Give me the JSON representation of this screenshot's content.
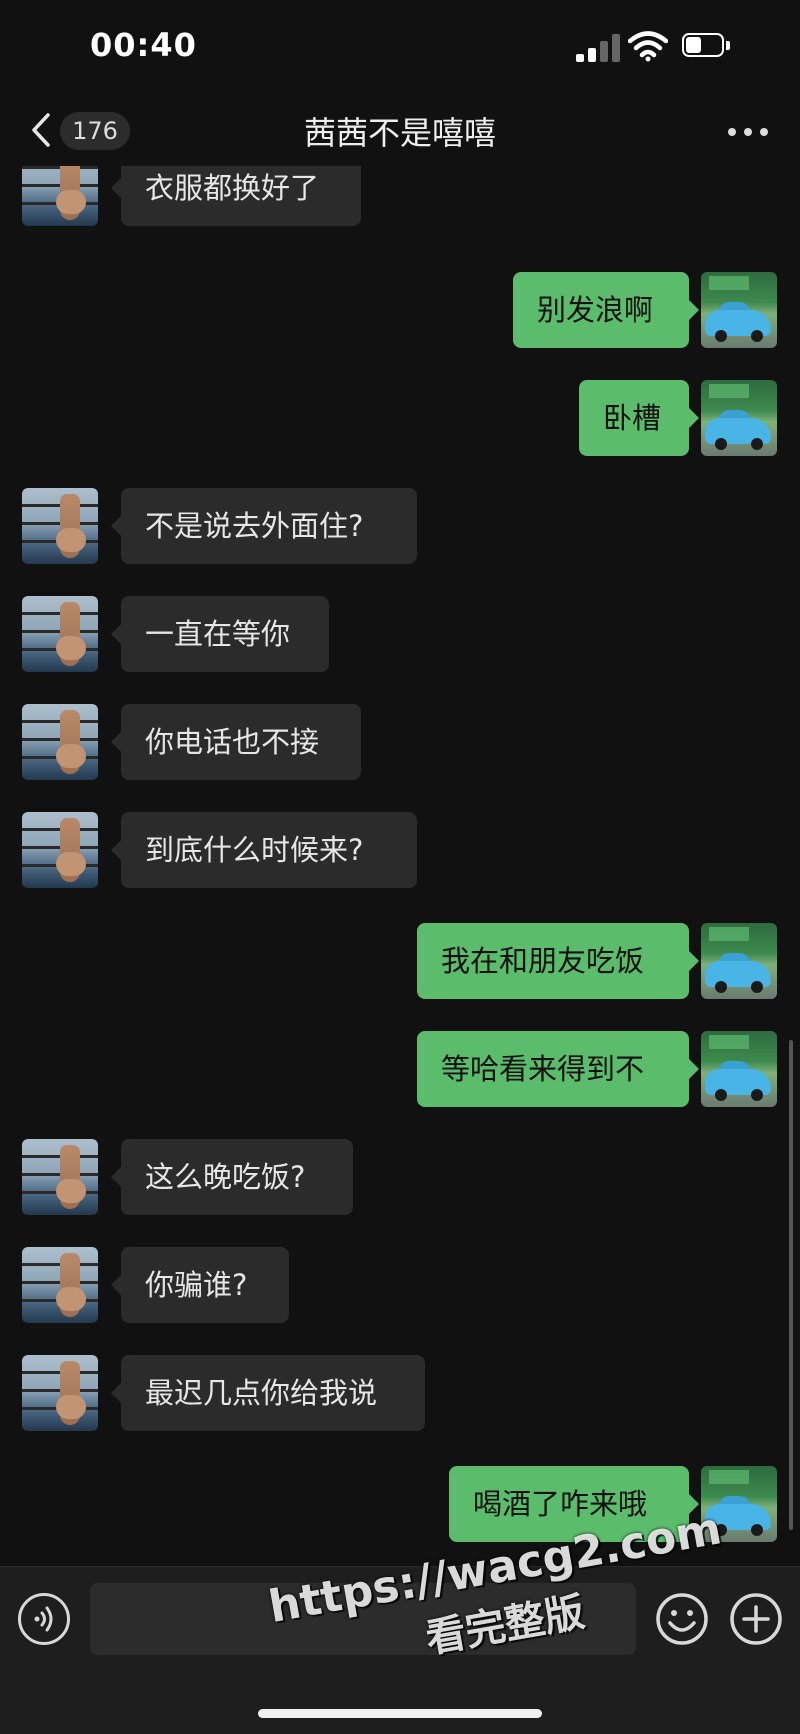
{
  "status_bar": {
    "time": "00:40",
    "battery_level": 0.45
  },
  "header": {
    "back_icon": "chevron-left-icon",
    "unread_count": "176",
    "title": "茜茜不是嘻嘻",
    "more_icon": "more-dots-icon"
  },
  "messages": [
    {
      "side": "left",
      "text": "衣服都换好了"
    },
    {
      "side": "right",
      "text": "别发浪啊"
    },
    {
      "side": "right",
      "text": "卧槽"
    },
    {
      "side": "left",
      "text": "不是说去外面住?"
    },
    {
      "side": "left",
      "text": "一直在等你"
    },
    {
      "side": "left",
      "text": "你电话也不接"
    },
    {
      "side": "left",
      "text": "到底什么时候来?"
    },
    {
      "side": "right",
      "text": "我在和朋友吃饭"
    },
    {
      "side": "right",
      "text": "等哈看来得到不"
    },
    {
      "side": "left",
      "text": "这么晚吃饭?"
    },
    {
      "side": "left",
      "text": "你骗谁?"
    },
    {
      "side": "left",
      "text": "最迟几点你给我说"
    },
    {
      "side": "right",
      "text": "喝酒了咋来哦"
    }
  ],
  "input_bar": {
    "voice_icon": "voice-icon",
    "input_value": "",
    "emoji_icon": "emoji-icon",
    "add_icon": "plus-icon"
  },
  "watermark": {
    "url": "https://wacg2.com",
    "subtitle": "看完整版"
  },
  "colors": {
    "background": "#111111",
    "incoming_bubble": "#2b2b2b",
    "outgoing_bubble": "#5bbd6b"
  }
}
